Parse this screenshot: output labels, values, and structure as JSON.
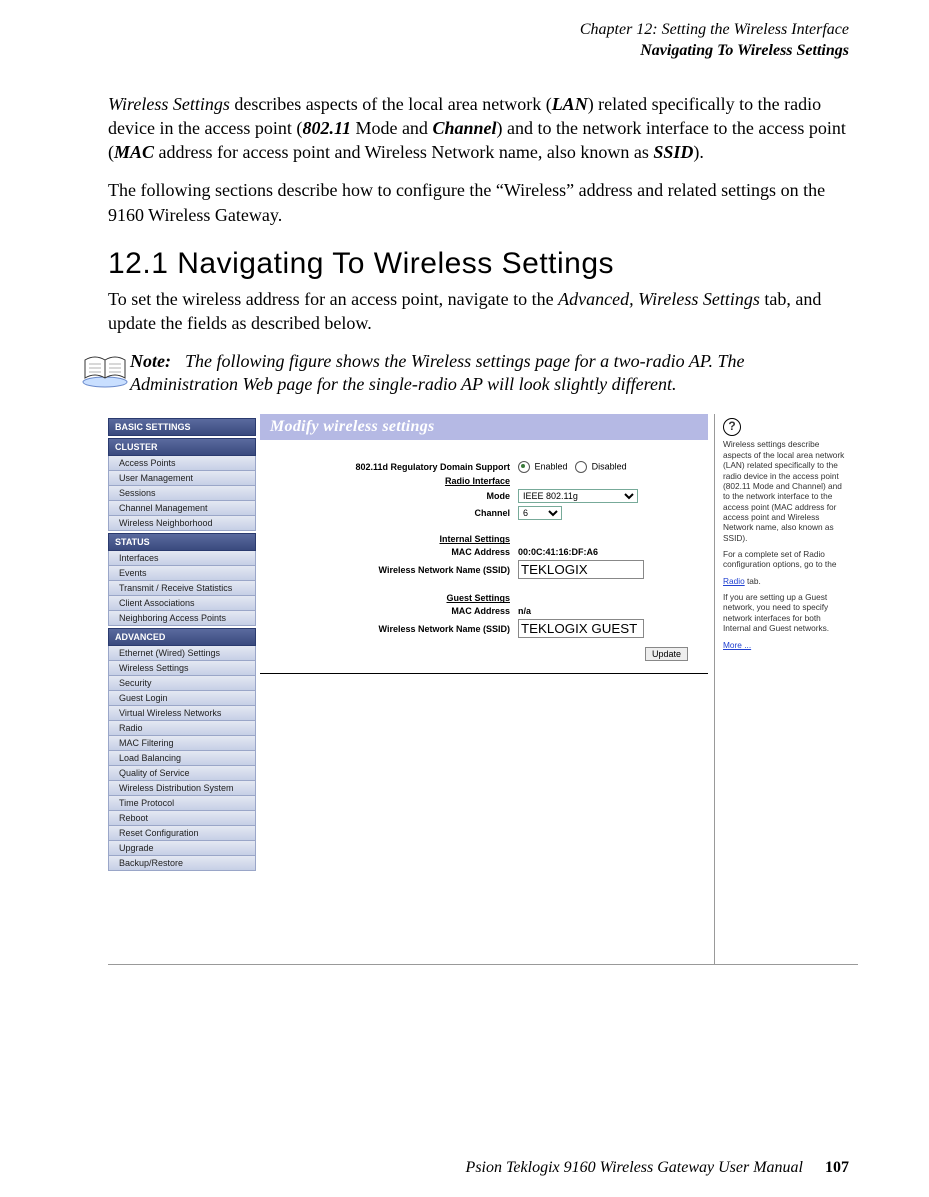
{
  "header": {
    "line1": "Chapter 12:  Setting the Wireless Interface",
    "line2": "Navigating To Wireless Settings"
  },
  "para1_pre": "Wireless Settings",
  "para1_mid1": " describes aspects of the local area network (",
  "para1_lan": "LAN",
  "para1_mid2": ") related specifically to the radio device in the access point (",
  "para1_802": "802.11",
  "para1_mid3": " Mode and ",
  "para1_channel": "Channel",
  "para1_mid4": ") and to the network interface to the access point (",
  "para1_mac": "MAC",
  "para1_mid5": " address for access point and Wireless Network name, also known as ",
  "para1_ssid": "SSID",
  "para1_end": ").",
  "para2": "The following sections describe how to configure the “Wireless” address and related settings on the 9160 Wireless Gateway.",
  "section_heading": "12.1  Navigating To Wireless Settings",
  "para3_a": "To set the wireless address for an access point, navigate to the ",
  "para3_i": "Advanced, Wireless Settings",
  "para3_b": " tab, and update the fields as described below.",
  "note_label": "Note:",
  "note_text": "The following figure shows the Wireless settings page for a two-radio AP. The Administration Web page for the single-radio AP will look slightly different.",
  "nav": {
    "basic": "BASIC SETTINGS",
    "cluster": "CLUSTER",
    "cluster_items": [
      "Access Points",
      "User Management",
      "Sessions",
      "Channel Management",
      "Wireless Neighborhood"
    ],
    "status": "STATUS",
    "status_items": [
      "Interfaces",
      "Events",
      "Transmit / Receive Statistics",
      "Client Associations",
      "Neighboring Access Points"
    ],
    "advanced": "ADVANCED",
    "advanced_items": [
      "Ethernet (Wired) Settings",
      "Wireless Settings",
      "Security",
      "Guest Login",
      "Virtual Wireless Networks",
      "Radio",
      "MAC Filtering",
      "Load Balancing",
      "Quality of Service",
      "Wireless Distribution System",
      "Time Protocol",
      "Reboot",
      "Reset Configuration",
      "Upgrade",
      "Backup/Restore"
    ]
  },
  "panel": {
    "title": "Modify wireless settings",
    "reg_label": "802.11d Regulatory Domain Support",
    "enabled": "Enabled",
    "disabled": "Disabled",
    "radio_interface": "Radio Interface",
    "mode_label": "Mode",
    "mode_value": "IEEE 802.11g",
    "channel_label": "Channel",
    "channel_value": "6",
    "internal": "Internal Settings",
    "mac_label": "MAC Address",
    "mac_internal": "00:0C:41:16:DF:A6",
    "ssid_label": "Wireless Network Name (SSID)",
    "ssid_internal": "TEKLOGIX",
    "guest": "Guest Settings",
    "mac_guest": "n/a",
    "ssid_guest": "TEKLOGIX GUEST",
    "update": "Update"
  },
  "help": {
    "p1": "Wireless settings describe aspects of the local area network (LAN) related specifically to the radio device in the access point (802.11 Mode and Channel) and to the network interface to the access point (MAC address for access point and Wireless Network name, also known as SSID).",
    "p2a": "For a complete set of Radio configuration options, go to the ",
    "p2link": "Radio",
    "p2b": " tab.",
    "p3": "If you are setting up a Guest network, you need to specify network interfaces for both Internal and Guest networks.",
    "more": "More ..."
  },
  "footer": {
    "text": "Psion Teklogix 9160 Wireless Gateway User Manual",
    "page": "107"
  }
}
